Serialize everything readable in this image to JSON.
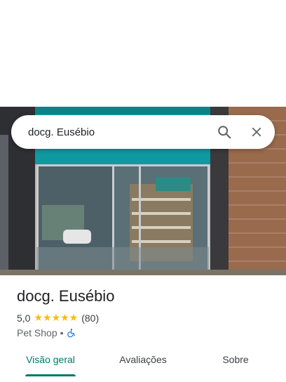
{
  "search": {
    "query": "docg. Eusébio"
  },
  "place": {
    "name": "docg. Eusébio",
    "rating": "5,0",
    "stars": "★★★★★",
    "review_count": "(80)",
    "category": "Pet Shop",
    "separator": "•"
  },
  "tabs": [
    {
      "label": "Visão geral",
      "active": true
    },
    {
      "label": "Avaliações"
    },
    {
      "label": "Sobre"
    }
  ],
  "icons": {
    "search": "search-icon",
    "close": "close-icon",
    "accessibility": "wheelchair-icon"
  },
  "colors": {
    "accent": "#00796b",
    "stars": "#fbbc04",
    "accessibility": "#1a73e8"
  }
}
